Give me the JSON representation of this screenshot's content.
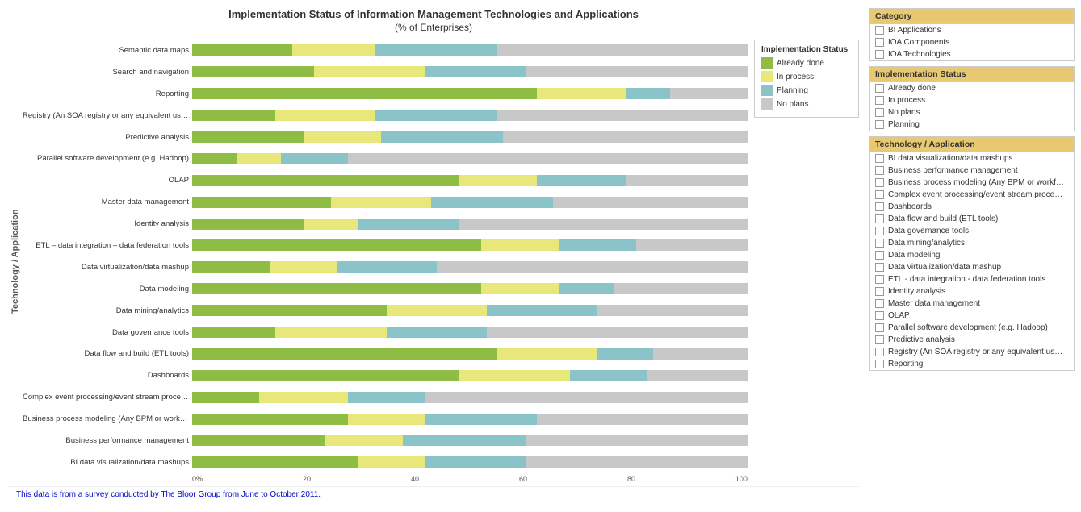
{
  "title": "Implementation Status of Information Management Technologies and Applications",
  "subtitle": "(% of Enterprises)",
  "footer": "This data is from a survey conducted by The Bloor Group from June to October 2011.",
  "legend": {
    "title": "Implementation Status",
    "items": [
      {
        "label": "Already  done",
        "class": "already-done"
      },
      {
        "label": "In process",
        "class": "in-process"
      },
      {
        "label": "Planning",
        "class": "planning"
      },
      {
        "label": "No plans",
        "class": "no-plans"
      }
    ]
  },
  "xAxis": [
    "0%",
    "20",
    "40",
    "60",
    "80",
    "100"
  ],
  "bars": [
    {
      "label": "Semantic data maps",
      "already": 18,
      "process": 15,
      "planning": 22,
      "noplans": 45
    },
    {
      "label": "Search and navigation",
      "already": 22,
      "process": 20,
      "planning": 18,
      "noplans": 40
    },
    {
      "label": "Reporting",
      "already": 62,
      "process": 16,
      "planning": 8,
      "noplans": 14
    },
    {
      "label": "Registry (An SOA registry or any equivalent used for BI)",
      "already": 15,
      "process": 18,
      "planning": 22,
      "noplans": 45
    },
    {
      "label": "Predictive analysis",
      "already": 20,
      "process": 14,
      "planning": 22,
      "noplans": 44
    },
    {
      "label": "Parallel software development (e.g. Hadoop)",
      "already": 8,
      "process": 8,
      "planning": 12,
      "noplans": 72
    },
    {
      "label": "OLAP",
      "already": 48,
      "process": 14,
      "planning": 16,
      "noplans": 22
    },
    {
      "label": "Master data management",
      "already": 25,
      "process": 18,
      "planning": 22,
      "noplans": 35
    },
    {
      "label": "Identity analysis",
      "already": 20,
      "process": 10,
      "planning": 18,
      "noplans": 52
    },
    {
      "label": "ETL – data integration – data federation tools",
      "already": 52,
      "process": 14,
      "planning": 14,
      "noplans": 20
    },
    {
      "label": "Data virtualization/data mashup",
      "already": 14,
      "process": 12,
      "planning": 18,
      "noplans": 56
    },
    {
      "label": "Data modeling",
      "already": 52,
      "process": 14,
      "planning": 10,
      "noplans": 24
    },
    {
      "label": "Data mining/analytics",
      "already": 35,
      "process": 18,
      "planning": 20,
      "noplans": 27
    },
    {
      "label": "Data governance tools",
      "already": 15,
      "process": 20,
      "planning": 18,
      "noplans": 47
    },
    {
      "label": "Data flow and build (ETL tools)",
      "already": 55,
      "process": 18,
      "planning": 10,
      "noplans": 17
    },
    {
      "label": "Dashboards",
      "already": 48,
      "process": 20,
      "planning": 14,
      "noplans": 18
    },
    {
      "label": "Complex event processing/event stream processing",
      "already": 12,
      "process": 16,
      "planning": 14,
      "noplans": 58
    },
    {
      "label": "Business process modeling (Any BPM or workflow tools used for BI)",
      "already": 28,
      "process": 14,
      "planning": 20,
      "noplans": 38
    },
    {
      "label": "Business performance management",
      "already": 24,
      "process": 14,
      "planning": 22,
      "noplans": 40
    },
    {
      "label": "BI data visualization/data mashups",
      "already": 30,
      "process": 12,
      "planning": 18,
      "noplans": 40
    }
  ],
  "rightPanel": {
    "category": {
      "header": "Category",
      "items": [
        {
          "label": "BI Applications"
        },
        {
          "label": "IOA Components"
        },
        {
          "label": "IOA Technologies"
        }
      ]
    },
    "implementationStatus": {
      "header": "Implementation Status",
      "items": [
        {
          "label": "Already  done"
        },
        {
          "label": "In process"
        },
        {
          "label": "No plans"
        },
        {
          "label": "Planning"
        }
      ]
    },
    "techApplication": {
      "header": "Technology / Application",
      "items": [
        {
          "label": "BI data visualization/data mashups"
        },
        {
          "label": "Business performance management"
        },
        {
          "label": "Business process modeling (Any BPM or workflow"
        },
        {
          "label": "Complex event processing/event stream processin"
        },
        {
          "label": "Dashboards"
        },
        {
          "label": "Data flow and build (ETL tools)"
        },
        {
          "label": "Data governance tools"
        },
        {
          "label": "Data mining/analytics"
        },
        {
          "label": "Data modeling"
        },
        {
          "label": "Data virtualization/data mashup"
        },
        {
          "label": "ETL - data integration - data federation tools"
        },
        {
          "label": "Identity analysis"
        },
        {
          "label": "Master data management"
        },
        {
          "label": "OLAP"
        },
        {
          "label": "Parallel software development (e.g. Hadoop)"
        },
        {
          "label": "Predictive analysis"
        },
        {
          "label": "Registry (An SOA registry or any equivalent used f"
        },
        {
          "label": "Reporting"
        }
      ]
    }
  },
  "yAxisLabel": "Technology / Application"
}
